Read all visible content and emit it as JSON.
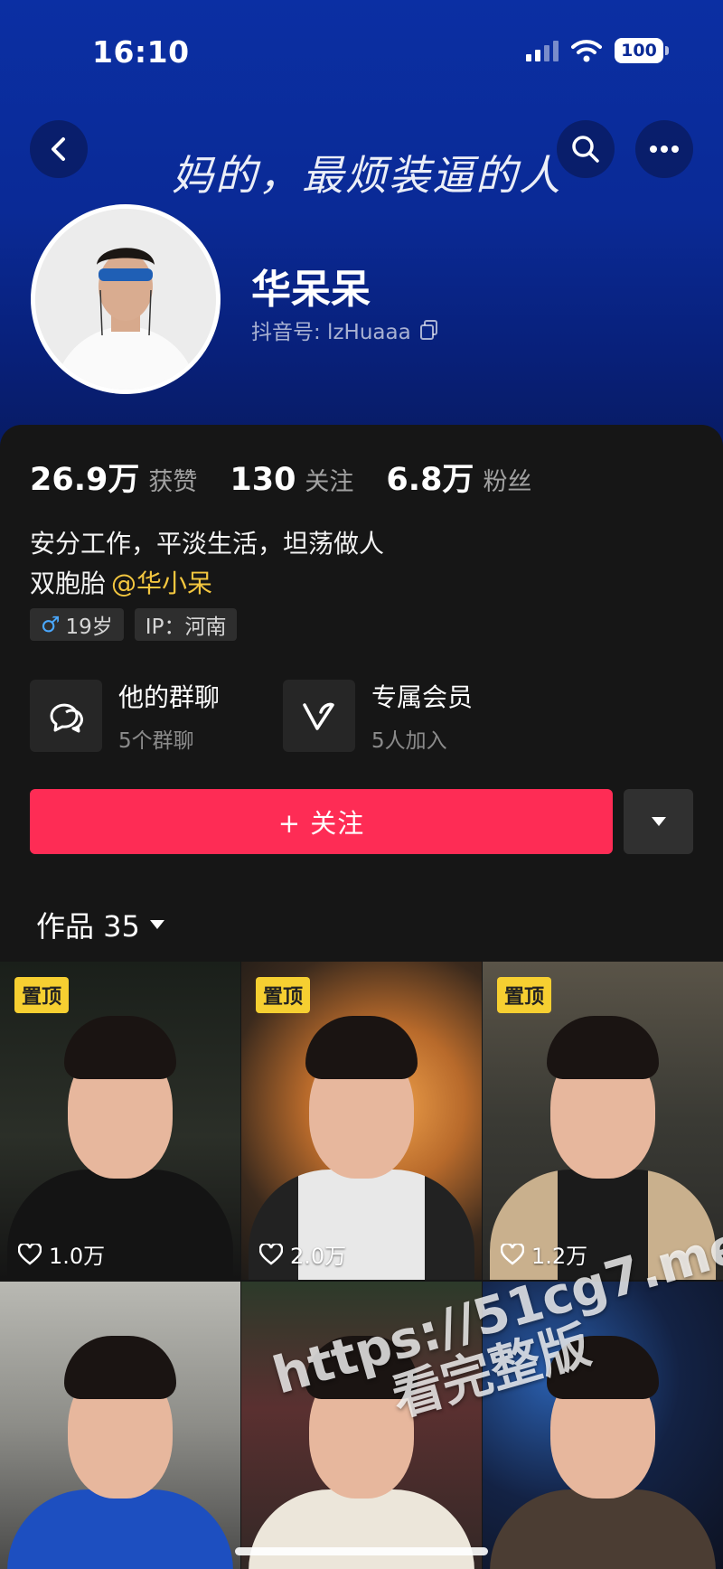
{
  "status_bar": {
    "time": "16:10",
    "battery": "100"
  },
  "header": {
    "banner": "妈的，最烦装逼的人",
    "name": "华呆呆",
    "handle": "抖音号: lzHuaaa"
  },
  "stats": [
    {
      "num": "26.9万",
      "label": "获赞"
    },
    {
      "num": "130",
      "label": "关注"
    },
    {
      "num": "6.8万",
      "label": "粉丝"
    }
  ],
  "bio": {
    "line1": "安分工作，平淡生活，坦荡做人",
    "line2_prefix": "双胞胎",
    "mention": "@华小呆"
  },
  "tags": {
    "gender_icon": "male-icon",
    "age": "19岁",
    "ip": "IP：河南"
  },
  "features": [
    {
      "title": "他的群聊",
      "sub": "5个群聊",
      "icon": "chat-bubbles-icon"
    },
    {
      "title": "专属会员",
      "sub": "5人加入",
      "icon": "vip-v-icon"
    }
  ],
  "actions": {
    "follow_label": "+ 关注"
  },
  "works_tab": {
    "label": "作品 35"
  },
  "videos": [
    {
      "pinned": "置顶",
      "likes": "1.0万"
    },
    {
      "pinned": "置顶",
      "likes": "2.0万"
    },
    {
      "pinned": "置顶",
      "likes": "1.2万"
    },
    {
      "pinned": "",
      "likes": ""
    },
    {
      "pinned": "",
      "likes": ""
    },
    {
      "pinned": "",
      "likes": ""
    }
  ],
  "watermark": {
    "line1": "https://51cg7.me",
    "line2": "看完整版"
  },
  "colors": {
    "accent": "#fe2c55",
    "mention": "#f3c63f",
    "header_blue": "#0b2fa3",
    "pin": "#f6cf31"
  }
}
